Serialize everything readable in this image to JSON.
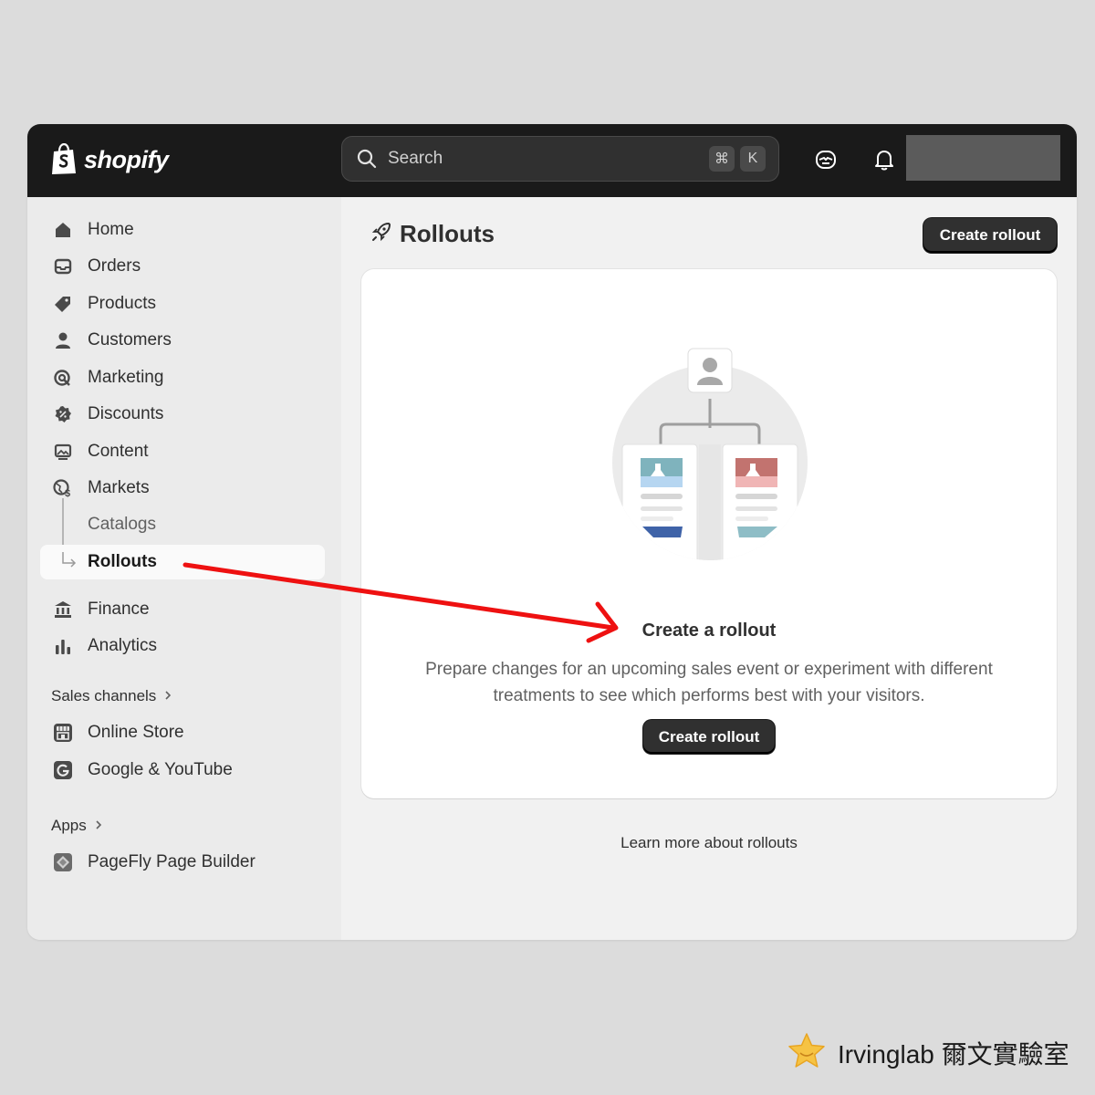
{
  "app": {
    "logo_text": "shopify"
  },
  "search": {
    "placeholder": "Search",
    "shortcut_cmd": "⌘",
    "shortcut_key": "K"
  },
  "sidebar": {
    "items": [
      {
        "label": "Home"
      },
      {
        "label": "Orders"
      },
      {
        "label": "Products"
      },
      {
        "label": "Customers"
      },
      {
        "label": "Marketing"
      },
      {
        "label": "Discounts"
      },
      {
        "label": "Content"
      },
      {
        "label": "Markets"
      },
      {
        "label": "Catalogs"
      },
      {
        "label": "Rollouts"
      },
      {
        "label": "Finance"
      },
      {
        "label": "Analytics"
      }
    ],
    "sales_channels": {
      "title": "Sales channels",
      "items": [
        {
          "label": "Online Store"
        },
        {
          "label": "Google & YouTube"
        }
      ]
    },
    "apps": {
      "title": "Apps",
      "items": [
        {
          "label": "PageFly Page Builder"
        }
      ]
    }
  },
  "main": {
    "title": "Rollouts",
    "create_button": "Create rollout",
    "empty_state": {
      "title": "Create a rollout",
      "description": "Prepare changes for an upcoming sales event or experiment with different treatments to see which performs best with your visitors.",
      "button": "Create rollout"
    },
    "learn_more": "Learn more about rollouts"
  },
  "colors": {
    "topbar": "#1a1a1a",
    "annotation_arrow": "#ee1111",
    "illustration_teal": "#7fb3bd",
    "illustration_rose": "#c2736f",
    "illustration_blue": "#3f63a8"
  },
  "watermark": {
    "text": "Irvinglab 爾文實驗室"
  }
}
